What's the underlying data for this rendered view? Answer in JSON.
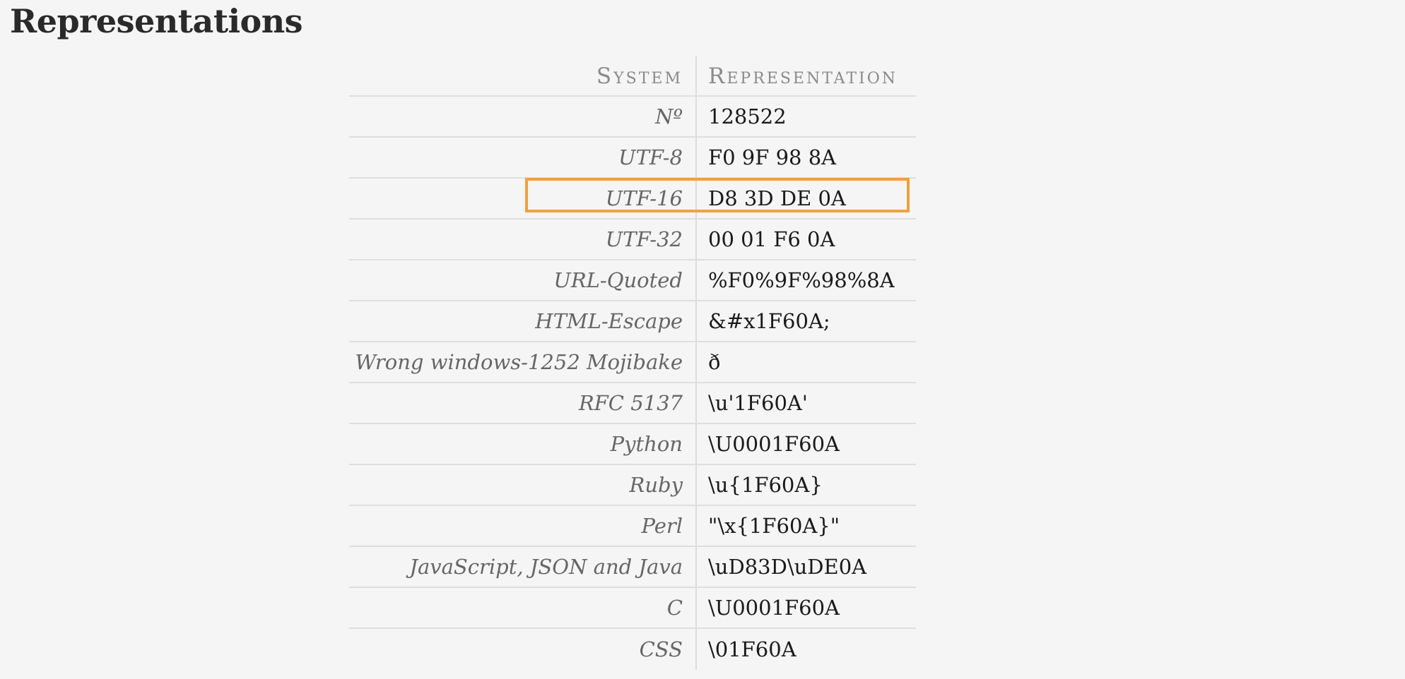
{
  "page": {
    "title": "Representations"
  },
  "table": {
    "headers": {
      "system": "System",
      "representation": "Representation"
    },
    "rows": [
      {
        "system": "Nº",
        "representation": "128522"
      },
      {
        "system": "UTF-8",
        "representation": "F0 9F 98 8A"
      },
      {
        "system": "UTF-16",
        "representation": "D8 3D DE 0A",
        "highlighted": true
      },
      {
        "system": "UTF-32",
        "representation": "00 01 F6 0A"
      },
      {
        "system": "URL-Quoted",
        "representation": "%F0%9F%98%8A"
      },
      {
        "system": "HTML-Escape",
        "representation": "&#x1F60A;"
      },
      {
        "system": "Wrong windows-1252 Mojibake",
        "representation": "ð"
      },
      {
        "system": "RFC 5137",
        "representation": "\\u'1F60A'"
      },
      {
        "system": "Python",
        "representation": "\\U0001F60A"
      },
      {
        "system": "Ruby",
        "representation": "\\u{1F60A}"
      },
      {
        "system": "Perl",
        "representation": "\"\\x{1F60A}\""
      },
      {
        "system": "JavaScript, JSON and Java",
        "representation": "\\uD83D\\uDE0A"
      },
      {
        "system": "C",
        "representation": "\\U0001F60A"
      },
      {
        "system": "CSS",
        "representation": "\\01F60A"
      }
    ]
  },
  "colors": {
    "highlight": "#f0a040",
    "background": "#f5f5f5"
  }
}
